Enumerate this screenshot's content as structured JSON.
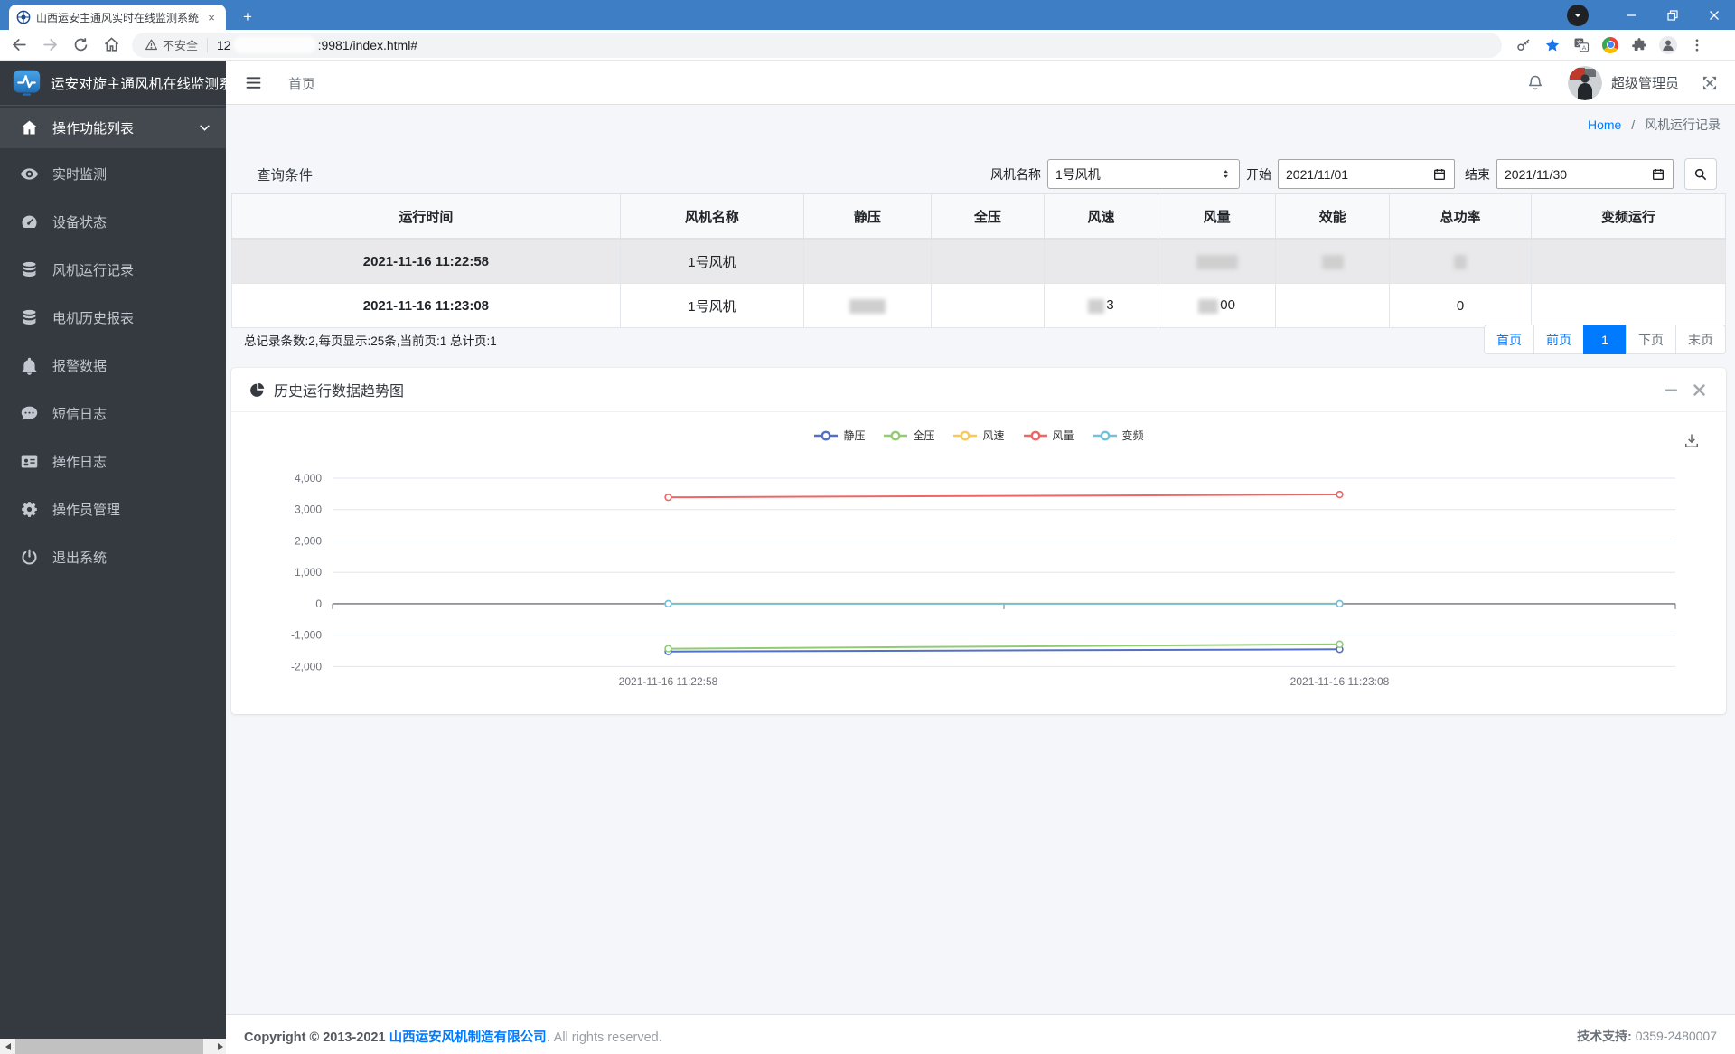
{
  "browser": {
    "tab": {
      "title": "山西运安主通风实时在线监测系统",
      "close_glyph": "×"
    },
    "new_tab_glyph": "+",
    "address": {
      "warning_text": "不安全",
      "url_prefix": "12",
      "url_redacted": true,
      "url_suffix": ":9981/index.html#"
    }
  },
  "sidebar": {
    "brand": "运安对旋主通风机在线监测系统",
    "items": [
      {
        "key": "menu-root",
        "icon": "home-icon",
        "label": "操作功能列表",
        "active": true
      },
      {
        "key": "realtime",
        "icon": "eye-icon",
        "label": "实时监测"
      },
      {
        "key": "device-status",
        "icon": "gauge-icon",
        "label": "设备状态"
      },
      {
        "key": "fan-run-records",
        "icon": "database-icon",
        "label": "风机运行记录"
      },
      {
        "key": "motor-history",
        "icon": "database-icon",
        "label": "电机历史报表"
      },
      {
        "key": "alarm-data",
        "icon": "bell-icon",
        "label": "报警数据"
      },
      {
        "key": "sms-log",
        "icon": "comment-icon",
        "label": "短信日志"
      },
      {
        "key": "operation-log",
        "icon": "idcard-icon",
        "label": "操作日志"
      },
      {
        "key": "operator-admin",
        "icon": "gear-icon",
        "label": "操作员管理"
      },
      {
        "key": "logout",
        "icon": "power-icon",
        "label": "退出系统"
      }
    ]
  },
  "topbar": {
    "home_link": "首页",
    "user_name": "超级管理员"
  },
  "breadcrumb": {
    "home": "Home",
    "sep": "/",
    "current": "风机运行记录"
  },
  "query": {
    "title": "查询条件",
    "fan_label": "风机名称",
    "fan_value": "1号风机",
    "start_label": "开始",
    "start_value": "2021/11/01",
    "end_label": "结束",
    "end_value": "2021/11/30"
  },
  "table": {
    "columns": [
      "运行时间",
      "风机名称",
      "静压",
      "全压",
      "风速",
      "风量",
      "效能",
      "总功率",
      "变频运行"
    ],
    "rows": [
      {
        "striped": true,
        "cells": [
          {
            "text": "2021-11-16 11:22:58",
            "bold": true
          },
          {
            "text": "1号风机"
          },
          {
            "text": ""
          },
          {
            "text": ""
          },
          {
            "text": ""
          },
          {
            "redact": 46
          },
          {
            "redact": 24
          },
          {
            "redact": 14
          },
          {
            "text": ""
          }
        ]
      },
      {
        "striped": false,
        "cells": [
          {
            "text": "2021-11-16 11:23:08",
            "bold": true
          },
          {
            "text": "1号风机"
          },
          {
            "redact": 40
          },
          {
            "text": ""
          },
          {
            "redact": 18,
            "text": "3"
          },
          {
            "redact": 22,
            "text": "00"
          },
          {
            "text": ""
          },
          {
            "text": "0"
          },
          {
            "text": ""
          }
        ]
      }
    ]
  },
  "records_info": "总记录条数:2,每页显示:25条,当前页:1 总计页:1",
  "pagination": [
    {
      "label": "首页",
      "style": "link"
    },
    {
      "label": "前页",
      "style": "link"
    },
    {
      "label": "1",
      "style": "active"
    },
    {
      "label": "下页",
      "style": "muted"
    },
    {
      "label": "末页",
      "style": "muted"
    }
  ],
  "chart_panel": {
    "title": "历史运行数据趋势图"
  },
  "chart_data": {
    "type": "line",
    "x": [
      "2021-11-16 11:22:58",
      "2021-11-16 11:23:08"
    ],
    "series": [
      {
        "name": "静压",
        "color": "#5470c6",
        "values": [
          -1520,
          -1450
        ]
      },
      {
        "name": "全压",
        "color": "#91cc75",
        "values": [
          -1430,
          -1290
        ]
      },
      {
        "name": "风速",
        "color": "#fac858",
        "values": [
          3,
          3
        ]
      },
      {
        "name": "风量",
        "color": "#ee6666",
        "values": [
          3390,
          3480
        ]
      },
      {
        "name": "变频",
        "color": "#73c0de",
        "values": [
          0,
          0
        ]
      }
    ],
    "ylim": [
      -2000,
      4000
    ],
    "ytick_step": 1000,
    "legend": [
      "静压",
      "全压",
      "风速",
      "风量",
      "变频"
    ],
    "legend_position": "top",
    "grid": true,
    "title": "历史运行数据趋势图",
    "xlabel": "",
    "ylabel": ""
  },
  "footer": {
    "copyright_prefix": "Copyright © 2013-2021",
    "company": "山西运安风机制造有限公司",
    "copyright_suffix": ". All rights reserved.",
    "support_label": "技术支持:",
    "support_value": "0359-2480007"
  },
  "colors": {
    "accent": "#007bff",
    "titlebar": "#3d7ec4",
    "sidebar_bg": "#343a40"
  }
}
